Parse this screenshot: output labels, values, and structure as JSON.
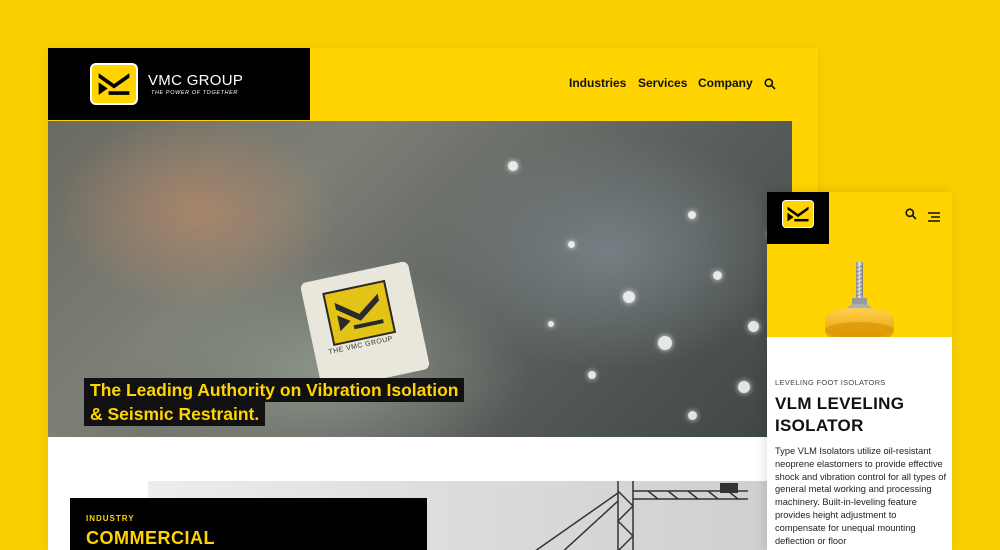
{
  "desktop": {
    "brand": {
      "name": "VMC GROUP",
      "tagline": "THE POWER OF TOGETHER"
    },
    "nav": {
      "items": [
        {
          "label": "Industries"
        },
        {
          "label": "Services"
        },
        {
          "label": "Company"
        }
      ]
    },
    "hero": {
      "title_line1": "The Leading Authority on Vibration Isolation",
      "title_line2": "& Seismic Restraint.",
      "patch_text": "THE VMC GROUP"
    },
    "industry": {
      "label": "INDUSTRY",
      "title": "COMMERCIAL"
    }
  },
  "mobile": {
    "product": {
      "category": "LEVELING FOOT ISOLATORS",
      "title_line1": "VLM LEVELING",
      "title_line2": "ISOLATOR",
      "description": "Type VLM Isolators utilize oil-resistant neoprene elastomers to provide effective shock and vibration control for all types of general metal working and processing machinery. Built-in-leveling feature provides height adjustment to compensate for unequal mounting deflection or floor"
    }
  },
  "colors": {
    "brand_yellow": "#FFD400",
    "background": "#F9CF00",
    "black": "#000000"
  },
  "icons": {
    "search": "search-icon",
    "menu": "menu-icon",
    "logo": "vmc-logo-icon"
  }
}
